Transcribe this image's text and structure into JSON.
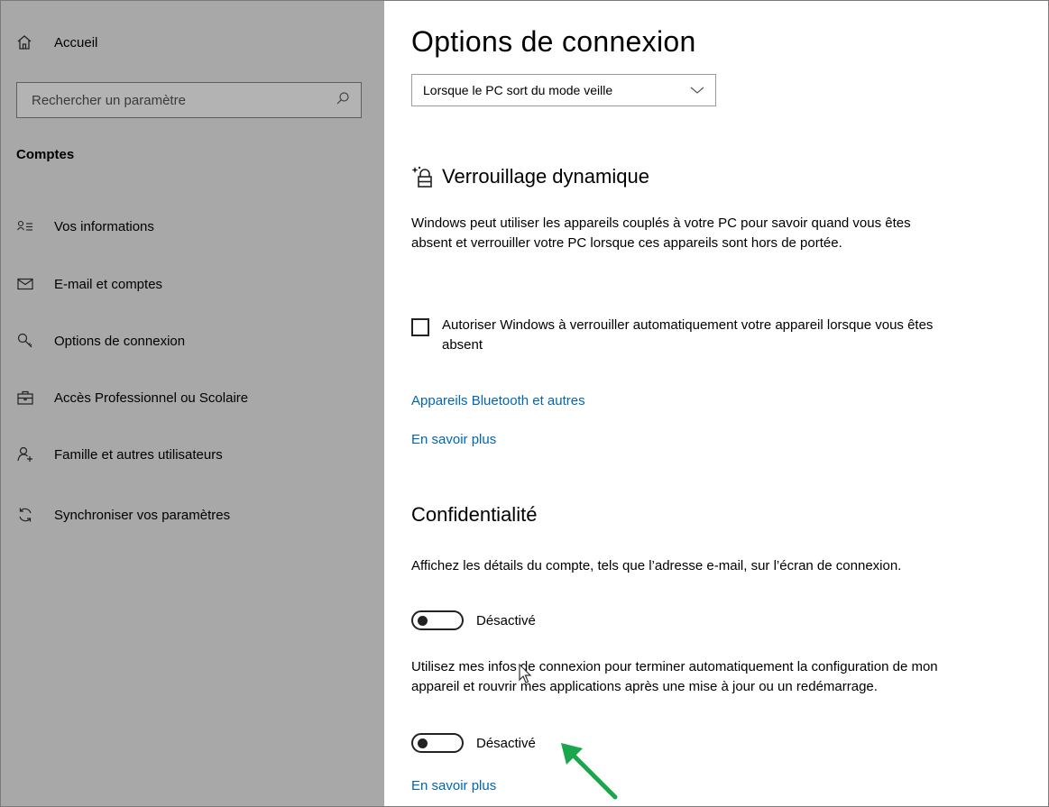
{
  "sidebar": {
    "home_label": "Accueil",
    "search_placeholder": "Rechercher un paramètre",
    "section_title": "Comptes",
    "items": [
      {
        "label": "Vos informations"
      },
      {
        "label": "E-mail et comptes"
      },
      {
        "label": "Options de connexion"
      },
      {
        "label": "Accès Professionnel ou Scolaire"
      },
      {
        "label": "Famille et autres utilisateurs"
      },
      {
        "label": "Synchroniser vos paramètres"
      }
    ]
  },
  "main": {
    "title": "Options de connexion",
    "wake_dropdown": {
      "value": "Lorsque le PC sort du mode veille"
    },
    "dynamic_lock": {
      "heading": "Verrouillage dynamique",
      "description": "Windows peut utiliser les appareils couplés à votre PC pour savoir quand vous êtes absent et verrouiller votre PC lorsque ces appareils sont hors de portée.",
      "checkbox_label": "Autoriser Windows à verrouiller automatiquement votre appareil lorsque vous êtes absent",
      "checkbox_checked": false,
      "link_bluetooth": "Appareils Bluetooth et autres",
      "link_learn_more": "En savoir plus"
    },
    "privacy": {
      "heading": "Confidentialité",
      "setting1_text": "Affichez les détails du compte, tels que l’adresse e-mail, sur l’écran de connexion.",
      "setting1_state": "Désactivé",
      "setting2_text": "Utilisez mes infos de connexion pour terminer automatiquement la configuration de mon appareil et rouvrir mes applications après une mise à jour ou un redémarrage.",
      "setting2_state": "Désactivé",
      "link_learn_more": "En savoir plus"
    }
  },
  "colors": {
    "sidebar_bg": "#a8a8a8",
    "link": "#0066b4",
    "annotation_arrow": "#1aa64b"
  }
}
